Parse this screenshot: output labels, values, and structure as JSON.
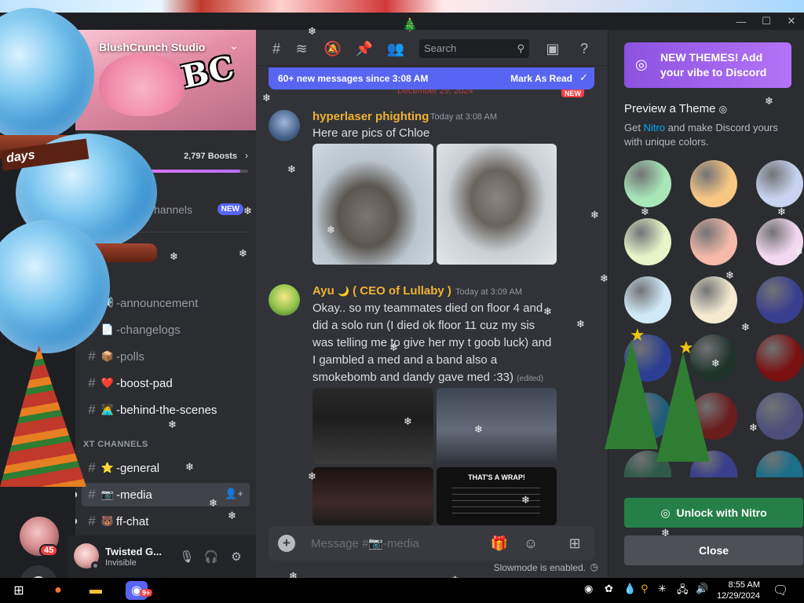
{
  "window": {
    "controls": {
      "minimize": "—",
      "maximize": "☐",
      "close": "✕"
    }
  },
  "server": {
    "name": "BlushCrunch Studio",
    "banner_text": "BC",
    "boosts": "2,797 Boosts",
    "boost_progress": 0.95,
    "browse_label": "hannels",
    "browse_badge": "NEW",
    "badge": "45"
  },
  "channels": [
    {
      "name": "-announcement",
      "emoji": "📢",
      "unread": false
    },
    {
      "name": "-changelogs",
      "emoji": "📄",
      "unread": false
    },
    {
      "name": "-polls",
      "emoji": "📦",
      "unread": false
    },
    {
      "name": "-boost-pad",
      "emoji": "❤️",
      "unread": true
    },
    {
      "name": "-behind-the-scenes",
      "emoji": "🧑‍💻",
      "unread": true
    }
  ],
  "text_category": "XT CHANNELS",
  "text_channels": [
    {
      "name": "-general",
      "emoji": "⭐",
      "unread": true
    },
    {
      "name": "-media",
      "emoji": "📷",
      "unread": true,
      "active": true
    },
    {
      "name": "ff-chat",
      "emoji": "🐻",
      "unread": true
    }
  ],
  "user": {
    "name": "Twisted G...",
    "status": "Invisible"
  },
  "header": {
    "search_placeholder": "Search"
  },
  "new_messages": {
    "text": "60+ new messages since 3:08 AM",
    "action": "Mark As Read",
    "date_divider": "December 29, 2024",
    "new_tag": "NEW"
  },
  "messages": [
    {
      "author": "hyperlaser phighting",
      "author_color": "#f0b232",
      "time": "Today at 3:08 AM",
      "text": "Here are pics of Chloe"
    },
    {
      "author": "Ayu",
      "author_tag": "( CEO of Lullaby )",
      "author_color": "#f0b232",
      "time": "Today at 3:09 AM",
      "text": "Okay.. so my teammates died on floor 4 and did a solo run (I died ok floor 11 cuz my sis was telling me to give her my t goob luck) and I gambled a med and a band also a smokebomb and dandy gave med :33)",
      "edited": "(edited)"
    }
  ],
  "screenshot_texts": {
    "wrap_title": "THAT'S A WRAP!",
    "earned": "You Earned... 280 Ichor!"
  },
  "composer": {
    "placeholder": "Message #📷-media",
    "slowmode": "Slowmode is enabled."
  },
  "right_panel": {
    "banner_title": "NEW THEMES! Add your vibe to Discord",
    "preview_title": "Preview a Theme",
    "preview_prefix": "Get",
    "nitro_word": "Nitro",
    "preview_suffix": "and make Discord yours with unique colors.",
    "unlock_label": "Unlock with Nitro",
    "close_label": "Close",
    "swatches": [
      "#a8e6b8",
      "#f9c784",
      "#c7d3f0",
      "#e7f5c9",
      "#f4b9a8",
      "#f3d9f0",
      "#cfe9f7",
      "#f3ead0",
      "#3a3e8f",
      "#2c3e91",
      "#20332b",
      "#7a1010",
      "#1f5c7a",
      "#6b1c1c",
      "#4b4f7a",
      "#2f5a4a",
      "#3a3f8a",
      "#1b6f89"
    ]
  },
  "taskbar": {
    "time": "8:55 AM",
    "date": "12/29/2024",
    "discord_badge": "9+"
  }
}
